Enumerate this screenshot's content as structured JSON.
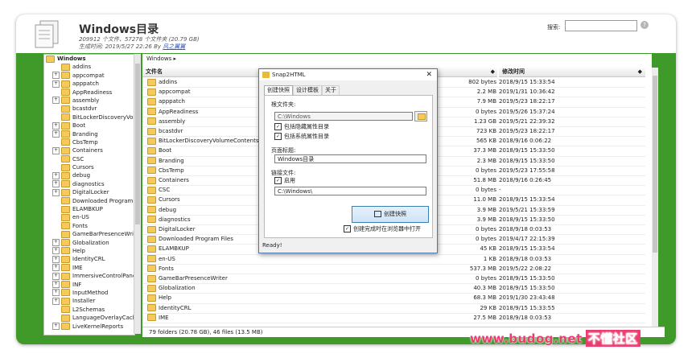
{
  "header": {
    "title": "Windows目录",
    "stats": "209912 个文件、57278 个文件夹 (20.79 GB)",
    "generated_prefix": "生成时间: 2019/5/27 22:26 By ",
    "generated_by": "风之翼翼",
    "search_label": "搜索:",
    "help": "?"
  },
  "tree": {
    "root": "Windows",
    "items": [
      {
        "label": "addins",
        "exp": false
      },
      {
        "label": "appcompat",
        "exp": true
      },
      {
        "label": "apppatch",
        "exp": true
      },
      {
        "label": "AppReadiness",
        "exp": false
      },
      {
        "label": "assembly",
        "exp": true
      },
      {
        "label": "bcastdvr",
        "exp": false
      },
      {
        "label": "BitLockerDiscoveryVolu",
        "exp": false
      },
      {
        "label": "Boot",
        "exp": true
      },
      {
        "label": "Branding",
        "exp": true
      },
      {
        "label": "CbsTemp",
        "exp": false
      },
      {
        "label": "Containers",
        "exp": true
      },
      {
        "label": "CSC",
        "exp": false
      },
      {
        "label": "Cursors",
        "exp": false
      },
      {
        "label": "debug",
        "exp": true
      },
      {
        "label": "diagnostics",
        "exp": true
      },
      {
        "label": "DigitalLocker",
        "exp": true
      },
      {
        "label": "Downloaded Program I",
        "exp": false
      },
      {
        "label": "ELAMBKUP",
        "exp": false
      },
      {
        "label": "en-US",
        "exp": false
      },
      {
        "label": "Fonts",
        "exp": false
      },
      {
        "label": "GameBarPresenceWrit",
        "exp": false
      },
      {
        "label": "Globalization",
        "exp": true
      },
      {
        "label": "Help",
        "exp": true
      },
      {
        "label": "IdentityCRL",
        "exp": true
      },
      {
        "label": "IME",
        "exp": true
      },
      {
        "label": "ImmersiveControlPane",
        "exp": true
      },
      {
        "label": "INF",
        "exp": true
      },
      {
        "label": "InputMethod",
        "exp": true
      },
      {
        "label": "Installer",
        "exp": true
      },
      {
        "label": "L2Schemas",
        "exp": false
      },
      {
        "label": "LanguageOverlayCach",
        "exp": false
      },
      {
        "label": "LiveKernelReports",
        "exp": true
      }
    ]
  },
  "main": {
    "breadcrumb": "Windows ▸",
    "columns": {
      "name": "文件名",
      "size": "◆",
      "date": "修改时间"
    },
    "rows": [
      {
        "name": "addins",
        "size": "802 bytes",
        "date": "2018/9/15 15:33:54"
      },
      {
        "name": "appcompat",
        "size": "2.2 MB",
        "date": "2019/1/31 10:36:42"
      },
      {
        "name": "apppatch",
        "size": "7.9 MB",
        "date": "2019/5/23 18:22:17"
      },
      {
        "name": "AppReadiness",
        "size": "0 bytes",
        "date": "2019/5/26 15:37:24"
      },
      {
        "name": "assembly",
        "size": "1.23 GB",
        "date": "2019/5/21 22:39:32"
      },
      {
        "name": "bcastdvr",
        "size": "723 KB",
        "date": "2019/5/23 18:22:17"
      },
      {
        "name": "BitLockerDiscoveryVolumeContents",
        "size": "565 KB",
        "date": "2018/9/16 0:06:22"
      },
      {
        "name": "Boot",
        "size": "37.3 MB",
        "date": "2018/9/15 15:33:50"
      },
      {
        "name": "Branding",
        "size": "2.3 MB",
        "date": "2018/9/15 15:33:50"
      },
      {
        "name": "CbsTemp",
        "size": "0 bytes",
        "date": "2019/5/23 17:55:58"
      },
      {
        "name": "Containers",
        "size": "51.8 MB",
        "date": "2018/9/16 0:26:45"
      },
      {
        "name": "CSC",
        "size": "0 bytes",
        "date": "-"
      },
      {
        "name": "Cursors",
        "size": "11.0 MB",
        "date": "2018/9/15 15:33:54"
      },
      {
        "name": "debug",
        "size": "3.9 MB",
        "date": "2019/5/21 15:33:59"
      },
      {
        "name": "diagnostics",
        "size": "3.9 MB",
        "date": "2018/9/15 15:33:50"
      },
      {
        "name": "DigitalLocker",
        "size": "0 bytes",
        "date": "2018/9/18 0:03:53"
      },
      {
        "name": "Downloaded Program Files",
        "size": "0 bytes",
        "date": "2019/4/17 22:15:39"
      },
      {
        "name": "ELAMBKUP",
        "size": "45 KB",
        "date": "2018/9/15 15:33:54"
      },
      {
        "name": "en-US",
        "size": "1 KB",
        "date": "2018/9/18 0:03:53"
      },
      {
        "name": "Fonts",
        "size": "537.3 MB",
        "date": "2019/5/22 2:08:22"
      },
      {
        "name": "GameBarPresenceWriter",
        "size": "0 bytes",
        "date": "2018/9/15 15:33:50"
      },
      {
        "name": "Globalization",
        "size": "40.3 MB",
        "date": "2018/9/15 15:33:50"
      },
      {
        "name": "Help",
        "size": "68.3 MB",
        "date": "2019/1/30 23:43:48"
      },
      {
        "name": "IdentityCRL",
        "size": "29 KB",
        "date": "2018/9/15 15:33:55"
      },
      {
        "name": "IME",
        "size": "27.5 MB",
        "date": "2018/9/18 0:03:53"
      }
    ],
    "status": "79 folders (20.78 GB), 46 files (13.5 MB)"
  },
  "dialog": {
    "title": "Snap2HTML",
    "close": "✕",
    "tabs": [
      "创建快照",
      "设计模板",
      "关于"
    ],
    "root_label": "根文件夹:",
    "root_value": "C:\\Windows",
    "include_hidden": "包括隐藏属性目录",
    "include_system": "包括系统属性目录",
    "page_title_label": "页面标题:",
    "page_title_value": "Windows目录",
    "link_label": "链接文件:",
    "enable": "启用",
    "link_value": "C:\\Windows\\",
    "create_button": "创建快照",
    "open_after": "创建完成时在浏览器中打开",
    "status": "Ready!"
  },
  "watermark": {
    "text": "www.budog.net",
    "badge": "不懂社区"
  }
}
